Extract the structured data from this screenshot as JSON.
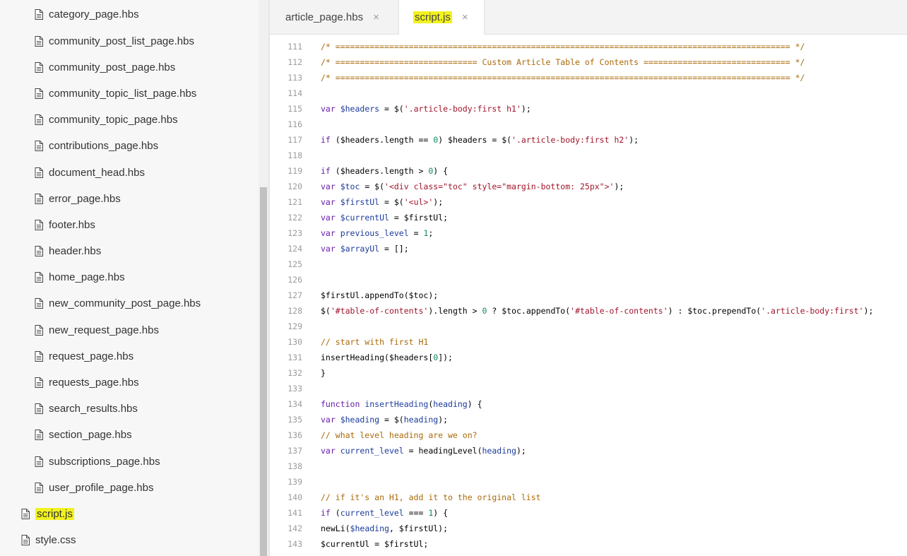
{
  "sidebar": {
    "files": [
      {
        "label": "category_page.hbs"
      },
      {
        "label": "community_post_list_page.hbs"
      },
      {
        "label": "community_post_page.hbs"
      },
      {
        "label": "community_topic_list_page.hbs"
      },
      {
        "label": "community_topic_page.hbs"
      },
      {
        "label": "contributions_page.hbs"
      },
      {
        "label": "document_head.hbs"
      },
      {
        "label": "error_page.hbs"
      },
      {
        "label": "footer.hbs"
      },
      {
        "label": "header.hbs"
      },
      {
        "label": "home_page.hbs"
      },
      {
        "label": "new_community_post_page.hbs"
      },
      {
        "label": "new_request_page.hbs"
      },
      {
        "label": "request_page.hbs"
      },
      {
        "label": "requests_page.hbs"
      },
      {
        "label": "search_results.hbs"
      },
      {
        "label": "section_page.hbs"
      },
      {
        "label": "subscriptions_page.hbs"
      },
      {
        "label": "user_profile_page.hbs"
      },
      {
        "label": "script.js",
        "highlighted": true
      },
      {
        "label": "style.css"
      }
    ]
  },
  "tabs": [
    {
      "label": "article_page.hbs",
      "close": "×",
      "active": false
    },
    {
      "label": "script.js",
      "close": "×",
      "active": true
    }
  ],
  "colors": {
    "highlight": "#f2f21f",
    "comment": "#aa6a0a",
    "keyword": "#6a1ea8",
    "variable": "#1a3a9a",
    "string": "#a0152b",
    "number": "#0f8a5a"
  },
  "editor": {
    "lines": [
      {
        "n": "111",
        "tokens": [
          [
            "c",
            "/* ============================================================================================= */"
          ]
        ]
      },
      {
        "n": "112",
        "tokens": [
          [
            "c",
            "/* ============================= Custom Article Table of Contents ============================== */"
          ]
        ]
      },
      {
        "n": "113",
        "tokens": [
          [
            "c",
            "/* ============================================================================================= */"
          ]
        ]
      },
      {
        "n": "114",
        "tokens": []
      },
      {
        "n": "115",
        "tokens": [
          [
            "k",
            "var "
          ],
          [
            "v",
            "$headers"
          ],
          [
            "p",
            " = $("
          ],
          [
            "s",
            "'.article-body:first h1'"
          ],
          [
            "p",
            ");"
          ]
        ]
      },
      {
        "n": "116",
        "tokens": []
      },
      {
        "n": "117",
        "tokens": [
          [
            "k",
            "if"
          ],
          [
            "p",
            " ($headers.length == "
          ],
          [
            "n",
            "0"
          ],
          [
            "p",
            ") $headers = $("
          ],
          [
            "s",
            "'.article-body:first h2'"
          ],
          [
            "p",
            ");"
          ]
        ]
      },
      {
        "n": "118",
        "tokens": []
      },
      {
        "n": "119",
        "tokens": [
          [
            "k",
            "if"
          ],
          [
            "p",
            " ($headers.length > "
          ],
          [
            "n",
            "0"
          ],
          [
            "p",
            ") {"
          ]
        ]
      },
      {
        "n": "120",
        "tokens": [
          [
            "k",
            "var "
          ],
          [
            "v",
            "$toc"
          ],
          [
            "p",
            " = $("
          ],
          [
            "s",
            "'<div class=\"toc\" style=\"margin-bottom: 25px\">'"
          ],
          [
            "p",
            ");"
          ]
        ]
      },
      {
        "n": "121",
        "tokens": [
          [
            "k",
            "var "
          ],
          [
            "v",
            "$firstUl"
          ],
          [
            "p",
            " = $("
          ],
          [
            "s",
            "'<ul>'"
          ],
          [
            "p",
            ");"
          ]
        ]
      },
      {
        "n": "122",
        "tokens": [
          [
            "k",
            "var "
          ],
          [
            "v",
            "$currentUl"
          ],
          [
            "p",
            " = $firstUl;"
          ]
        ]
      },
      {
        "n": "123",
        "tokens": [
          [
            "k",
            "var "
          ],
          [
            "v",
            "previous_level"
          ],
          [
            "p",
            " = "
          ],
          [
            "n",
            "1"
          ],
          [
            "p",
            ";"
          ]
        ]
      },
      {
        "n": "124",
        "tokens": [
          [
            "k",
            "var "
          ],
          [
            "v",
            "$arrayUl"
          ],
          [
            "p",
            " = [];"
          ]
        ]
      },
      {
        "n": "125",
        "tokens": []
      },
      {
        "n": "126",
        "tokens": []
      },
      {
        "n": "127",
        "tokens": [
          [
            "p",
            "$firstUl.appendTo($toc);"
          ]
        ]
      },
      {
        "n": "128",
        "tokens": [
          [
            "p",
            "$("
          ],
          [
            "s",
            "'#table-of-contents'"
          ],
          [
            "p",
            ").length > "
          ],
          [
            "n",
            "0"
          ],
          [
            "p",
            " ? $toc.appendTo("
          ],
          [
            "s",
            "'#table-of-contents'"
          ],
          [
            "p",
            ") : $toc.prependTo("
          ],
          [
            "s",
            "'.article-body:first'"
          ],
          [
            "p",
            ");"
          ]
        ]
      },
      {
        "n": "129",
        "tokens": []
      },
      {
        "n": "130",
        "tokens": [
          [
            "c",
            "// start with first H1"
          ]
        ]
      },
      {
        "n": "131",
        "tokens": [
          [
            "p",
            "insertHeading($headers["
          ],
          [
            "n",
            "0"
          ],
          [
            "p",
            "]);"
          ]
        ]
      },
      {
        "n": "132",
        "tokens": [
          [
            "p",
            "}"
          ]
        ]
      },
      {
        "n": "133",
        "tokens": []
      },
      {
        "n": "134",
        "tokens": [
          [
            "k",
            "function "
          ],
          [
            "f",
            "insertHeading"
          ],
          [
            "p",
            "("
          ],
          [
            "v",
            "heading"
          ],
          [
            "p",
            ") {"
          ]
        ]
      },
      {
        "n": "135",
        "tokens": [
          [
            "k",
            "var "
          ],
          [
            "v",
            "$heading"
          ],
          [
            "p",
            " = $("
          ],
          [
            "v",
            "heading"
          ],
          [
            "p",
            ");"
          ]
        ]
      },
      {
        "n": "136",
        "tokens": [
          [
            "c",
            "// what level heading are we on?"
          ]
        ]
      },
      {
        "n": "137",
        "tokens": [
          [
            "k",
            "var "
          ],
          [
            "v",
            "current_level"
          ],
          [
            "p",
            " = headingLevel("
          ],
          [
            "v",
            "heading"
          ],
          [
            "p",
            ");"
          ]
        ]
      },
      {
        "n": "138",
        "tokens": []
      },
      {
        "n": "139",
        "tokens": []
      },
      {
        "n": "140",
        "tokens": [
          [
            "c",
            "// if it's an H1, add it to the original list"
          ]
        ]
      },
      {
        "n": "141",
        "tokens": [
          [
            "k",
            "if"
          ],
          [
            "p",
            " ("
          ],
          [
            "v",
            "current_level"
          ],
          [
            "p",
            " === "
          ],
          [
            "n",
            "1"
          ],
          [
            "p",
            ") {"
          ]
        ]
      },
      {
        "n": "142",
        "tokens": [
          [
            "p",
            "newLi("
          ],
          [
            "v",
            "$heading"
          ],
          [
            "p",
            ", $firstUl);"
          ]
        ]
      },
      {
        "n": "143",
        "tokens": [
          [
            "p",
            "$currentUl = $firstUl;"
          ]
        ]
      }
    ]
  }
}
